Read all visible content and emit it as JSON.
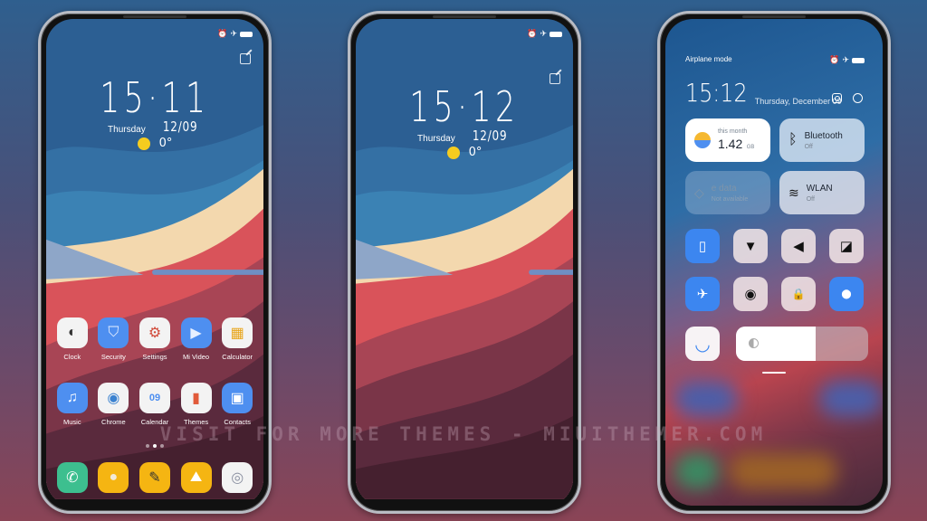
{
  "watermark": "VISIT FOR MORE THEMES - MIUITHEMER.COM",
  "colors": {
    "accent_blue": "#3c86f0",
    "sun": "#f5cc1f",
    "wall_sky": "#2e6ea6",
    "wall_sand": "#f3d8ae",
    "wall_red": "#d9535a",
    "wall_dark": "#4a2334"
  },
  "status_icons": [
    "alarm-icon",
    "airplane-icon",
    "battery-icon"
  ],
  "phone1": {
    "time_h": "15",
    "time_m": "11",
    "day": "Thursday",
    "date": "12/09",
    "temperature": "0°",
    "apps_row1": [
      {
        "label": "Clock",
        "icon": "clock-icon",
        "glyph": "◐"
      },
      {
        "label": "Security",
        "icon": "shield-icon",
        "glyph": "⛉"
      },
      {
        "label": "Settings",
        "icon": "settings-icon",
        "glyph": "⚙"
      },
      {
        "label": "Mi Video",
        "icon": "video-icon",
        "glyph": "▶"
      },
      {
        "label": "Calculator",
        "icon": "calculator-icon",
        "glyph": "▦"
      }
    ],
    "apps_row2": [
      {
        "label": "Music",
        "icon": "music-icon",
        "glyph": "♫"
      },
      {
        "label": "Chrome",
        "icon": "chrome-icon",
        "glyph": "◉"
      },
      {
        "label": "Calendar",
        "icon": "calendar-icon",
        "glyph": "09"
      },
      {
        "label": "Themes",
        "icon": "themes-icon",
        "glyph": "▮"
      },
      {
        "label": "Contacts",
        "icon": "contacts-icon",
        "glyph": "▣"
      }
    ],
    "dock": [
      {
        "icon": "phone-icon",
        "glyph": "✆"
      },
      {
        "icon": "browser-icon",
        "glyph": "●"
      },
      {
        "icon": "notes-icon",
        "glyph": "✎"
      },
      {
        "icon": "gallery-icon",
        "glyph": "⛰"
      },
      {
        "icon": "camera-icon",
        "glyph": "◎"
      }
    ]
  },
  "phone2": {
    "time_h": "15",
    "time_m": "12",
    "day": "Thursday",
    "date": "12/09",
    "temperature": "0°"
  },
  "phone3": {
    "carrier_text": "Airplane mode",
    "time": "15:12",
    "date": "Thursday, December 09",
    "data_tile": {
      "title": "this month",
      "value": "1.42",
      "unit": "GB"
    },
    "bluetooth_tile": {
      "title": "Bluetooth",
      "status": "Off"
    },
    "mobile_data_tile": {
      "title": "e data",
      "status": "Not available"
    },
    "wlan_tile": {
      "title": "WLAN",
      "status": "Off"
    },
    "toggles_row1": [
      {
        "name": "vibrate-toggle",
        "icon": "vibrate-icon",
        "glyph": "▯",
        "active": true
      },
      {
        "name": "flashlight-toggle",
        "icon": "flashlight-icon",
        "glyph": "▼",
        "active": false
      },
      {
        "name": "sound-toggle",
        "icon": "speaker-icon",
        "glyph": "◀",
        "active": false
      },
      {
        "name": "auto-brightness-toggle",
        "icon": "contrast-icon",
        "glyph": "◪",
        "active": false
      }
    ],
    "toggles_row2": [
      {
        "name": "airplane-toggle",
        "icon": "airplane-icon",
        "glyph": "✈",
        "active": true
      },
      {
        "name": "dark-mode-toggle",
        "icon": "dark-mode-icon",
        "glyph": "◉",
        "active": false
      },
      {
        "name": "lock-toggle",
        "icon": "lock-icon",
        "glyph": "🔒",
        "active": false
      },
      {
        "name": "location-toggle",
        "icon": "location-icon",
        "glyph": "⬤",
        "active": true
      }
    ],
    "face_toggle_glyph": "◡",
    "brightness_level": 0.6
  }
}
